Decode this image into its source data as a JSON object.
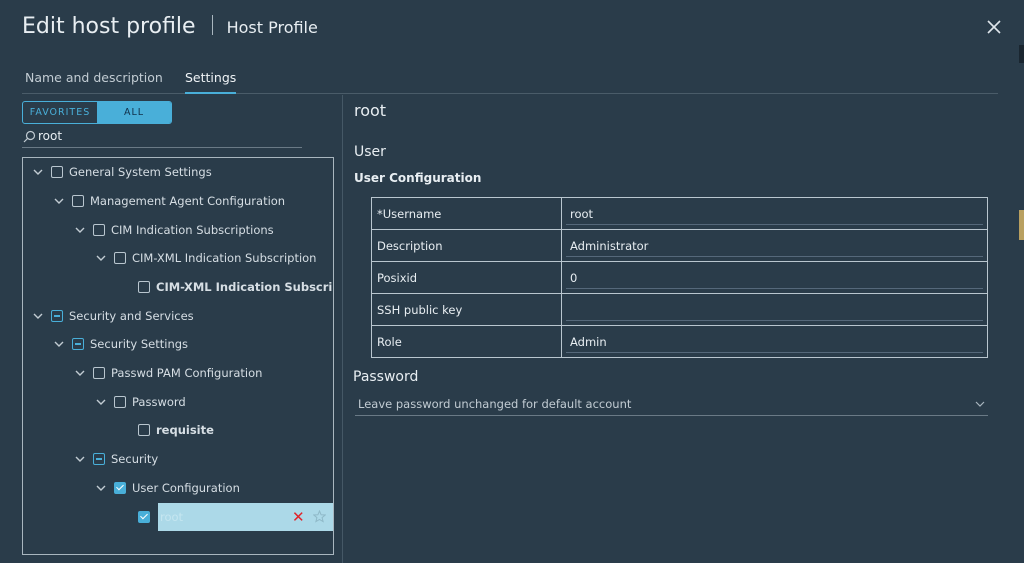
{
  "dialog": {
    "title": "Edit host profile",
    "subtitle": "Host Profile"
  },
  "tabs": [
    {
      "label": "Name and description",
      "active": false
    },
    {
      "label": "Settings",
      "active": true
    }
  ],
  "filter": {
    "favorites_label": "FAVORITES",
    "all_label": "ALL",
    "selected": "ALL"
  },
  "search": {
    "value": "root"
  },
  "tree": {
    "general_system_settings": "General System Settings",
    "management_agent_configuration": "Management Agent Configuration",
    "cim_indication_subscriptions": "CIM Indication Subscriptions",
    "cim_xml_indication_subscription": "CIM-XML Indication Subscription",
    "cim_xml_indication_subscrip": "CIM-XML Indication Subscrip...",
    "security_and_services": "Security and Services",
    "security_settings": "Security Settings",
    "passwd_pam_configuration": "Passwd PAM Configuration",
    "password": "Password",
    "requisite": "requisite",
    "security": "Security",
    "user_configuration": "User Configuration",
    "root": "root"
  },
  "details": {
    "heading": "root",
    "section": "User",
    "subsection": "User Configuration",
    "fields": [
      {
        "label": "*Username",
        "value": "root"
      },
      {
        "label": "Description",
        "value": "Administrator"
      },
      {
        "label": "Posixid",
        "value": "0"
      },
      {
        "label": "SSH public key",
        "value": ""
      },
      {
        "label": "Role",
        "value": "Admin"
      }
    ],
    "password_heading": "Password",
    "password_option": "Leave password unchanged for default account"
  },
  "colors": {
    "background": "#2a3c4a",
    "accent": "#49afd9",
    "selection": "#acd9e8",
    "remove": "#e0242a"
  },
  "icons": [
    "close-icon",
    "search-icon",
    "chevron-down-icon",
    "remove-icon",
    "star-icon"
  ]
}
